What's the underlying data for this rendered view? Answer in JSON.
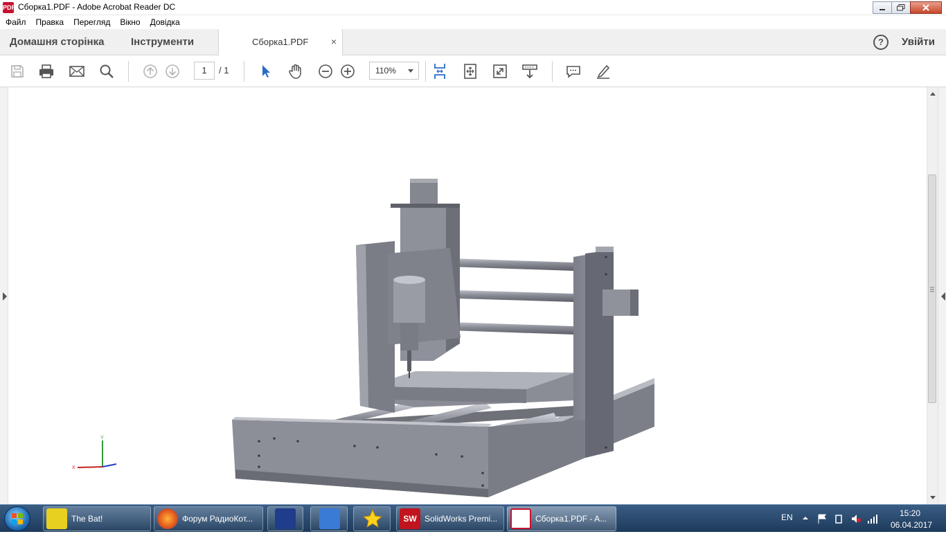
{
  "window": {
    "title": "Сборка1.PDF - Adobe Acrobat Reader DC",
    "app_icon_text": "PDF"
  },
  "menu": [
    "Файл",
    "Правка",
    "Перегляд",
    "Вікно",
    "Довідка"
  ],
  "tabs": {
    "home": "Домашня сторінка",
    "tools": "Інструменти",
    "document": "Сборка1.PDF",
    "close_symbol": "×",
    "help_symbol": "?",
    "sign_in": "Увійти"
  },
  "toolbar": {
    "page_current": "1",
    "page_total": "/ 1",
    "zoom": "110%"
  },
  "document": {
    "axis_y": "Y",
    "axis_x": "X"
  },
  "taskbar": {
    "items": [
      "The Bat!",
      "Форум РадиоКот...",
      "SolidWorks Premi...",
      "Сборка1.PDF - A..."
    ],
    "language": "EN",
    "time": "15:20",
    "date": "06.04.2017",
    "sw_icon_text": "SW"
  },
  "colors": {
    "accent_blue": "#2b6cc4",
    "taskbar": "#2a4a6e"
  }
}
